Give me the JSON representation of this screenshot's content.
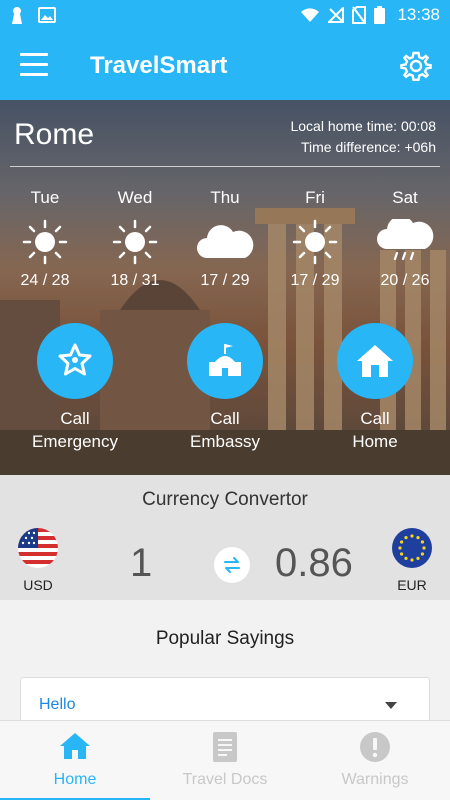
{
  "status_bar": {
    "time": "13:38"
  },
  "app_bar": {
    "title": "TravelSmart"
  },
  "location": {
    "city": "Rome",
    "local_home_time": "Local home time: 00:08",
    "time_difference": "Time difference: +06h"
  },
  "forecast": [
    {
      "day": "Tue",
      "icon": "sun-icon",
      "temp": "24 / 28"
    },
    {
      "day": "Wed",
      "icon": "sun-icon",
      "temp": "18 / 31"
    },
    {
      "day": "Thu",
      "icon": "cloud-icon",
      "temp": "17 / 29"
    },
    {
      "day": "Fri",
      "icon": "sun-icon",
      "temp": "17 / 29"
    },
    {
      "day": "Sat",
      "icon": "rain-cloud-icon",
      "temp": "20 / 26"
    }
  ],
  "actions": [
    {
      "line1": "Call",
      "line2": "Emergency",
      "icon": "police-badge-icon"
    },
    {
      "line1": "Call",
      "line2": "Embassy",
      "icon": "embassy-icon"
    },
    {
      "line1": "Call",
      "line2": "Home",
      "icon": "home-icon"
    }
  ],
  "currency": {
    "title": "Currency Convertor",
    "from_code": "USD",
    "from_amount": "1",
    "to_code": "EUR",
    "to_amount": "0.86"
  },
  "sayings": {
    "title": "Popular Sayings",
    "selected": "Hello"
  },
  "bottom_nav": {
    "tabs": [
      {
        "label": "Home",
        "icon": "home-icon",
        "active": true
      },
      {
        "label": "Travel Docs",
        "icon": "document-icon",
        "active": false
      },
      {
        "label": "Warnings",
        "icon": "warning-icon",
        "active": false
      }
    ]
  },
  "colors": {
    "accent": "#29b6f6"
  }
}
